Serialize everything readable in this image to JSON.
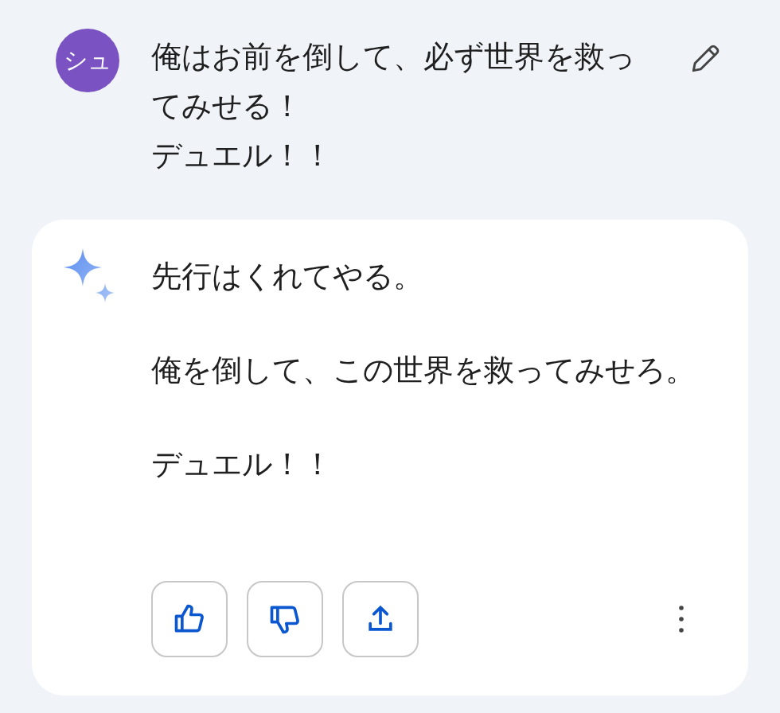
{
  "user_message": {
    "avatar": "シュ",
    "paragraphs": [
      "俺はお前を倒して、必ず世界を救ってみせる！",
      "デュエル！！"
    ]
  },
  "response": {
    "paragraphs": [
      "先行はくれてやる。",
      "俺を倒して、この世界を救ってみせろ。",
      "デュエル！！"
    ]
  },
  "actions": [
    {
      "kind": "like"
    },
    {
      "kind": "dislike"
    },
    {
      "kind": "share"
    }
  ]
}
